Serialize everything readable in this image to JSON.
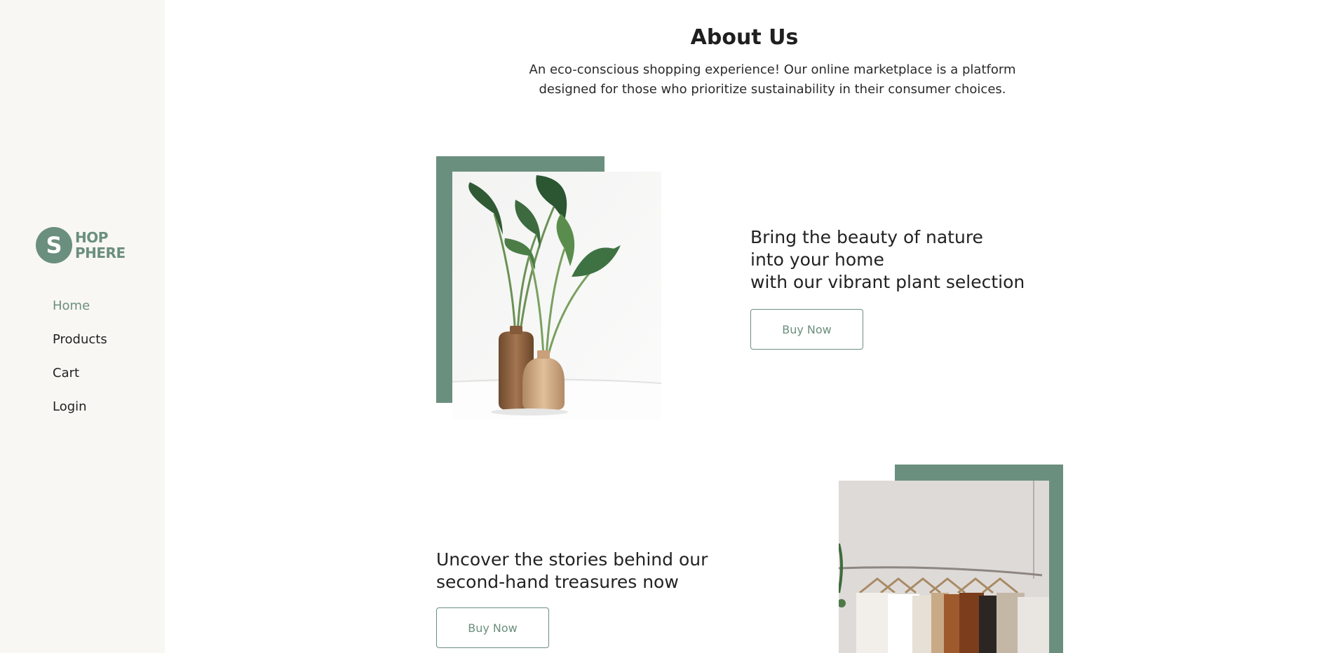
{
  "brand": {
    "initial": "S",
    "line1": "HOP",
    "line2": "PHERE",
    "color": "#6b8f7e"
  },
  "sidebar": {
    "items": [
      {
        "label": "Home",
        "active": true
      },
      {
        "label": "Products",
        "active": false
      },
      {
        "label": "Cart",
        "active": false
      },
      {
        "label": "Login",
        "active": false
      }
    ]
  },
  "about": {
    "title": "About Us",
    "description_line1": "An eco-conscious shopping experience! Our online marketplace is a platform",
    "description_line2": "designed for those who prioritize sustainability in their consumer choices."
  },
  "features": [
    {
      "lines": [
        "Bring the beauty of nature",
        "into your home",
        "with our vibrant plant selection"
      ],
      "button_label": "Buy Now",
      "image": "plant-vases-image"
    },
    {
      "lines": [
        "Uncover the stories behind our",
        "second-hand treasures now"
      ],
      "button_label": "Buy Now",
      "image": "clothing-rack-image"
    }
  ],
  "colors": {
    "accent": "#6b8f7e",
    "sidebar_bg": "#f9f7f3",
    "text": "#222222"
  }
}
